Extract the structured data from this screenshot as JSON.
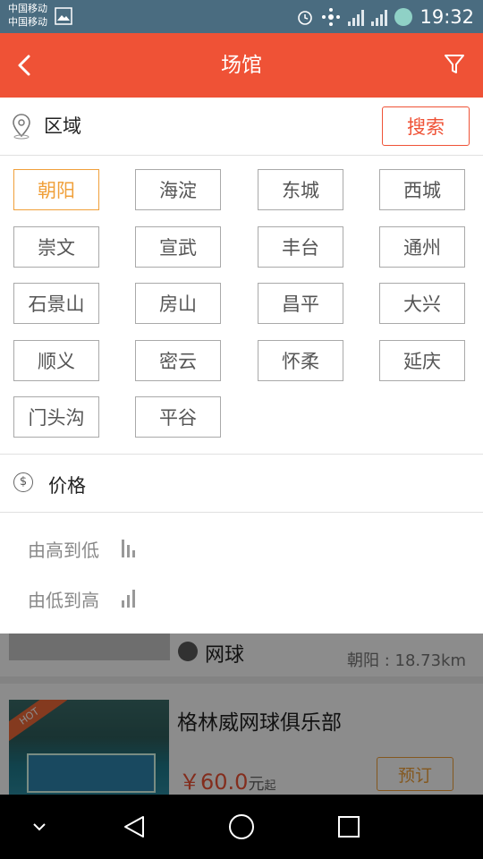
{
  "status_bar": {
    "carrier1": "中国移动",
    "carrier2": "中国移动",
    "time": "19:32"
  },
  "header": {
    "title": "场馆",
    "back_icon": "chevron-left-icon",
    "filter_icon": "filter-icon",
    "color": "#ef5236"
  },
  "region": {
    "label": "区域",
    "search_label": "搜索",
    "areas": [
      "朝阳",
      "海淀",
      "东城",
      "西城",
      "崇文",
      "宣武",
      "丰台",
      "通州",
      "石景山",
      "房山",
      "昌平",
      "大兴",
      "顺义",
      "密云",
      "怀柔",
      "延庆",
      "门头沟",
      "平谷"
    ],
    "selected": "朝阳",
    "selected_color": "#f0a03a"
  },
  "price": {
    "label": "价格",
    "sort_high_low": "由高到低",
    "sort_low_high": "由低到高"
  },
  "list": {
    "item1": {
      "sport": "网球",
      "distance": "朝阳 : 18.73km"
    },
    "item2": {
      "badge": "HOT",
      "name": "格林威网球俱乐部",
      "price": "￥60.0",
      "unit": "元",
      "qi": "起",
      "book_label": "预订"
    }
  },
  "nav": {
    "icons": [
      "collapse-icon",
      "back-icon",
      "home-icon",
      "recents-icon"
    ]
  }
}
